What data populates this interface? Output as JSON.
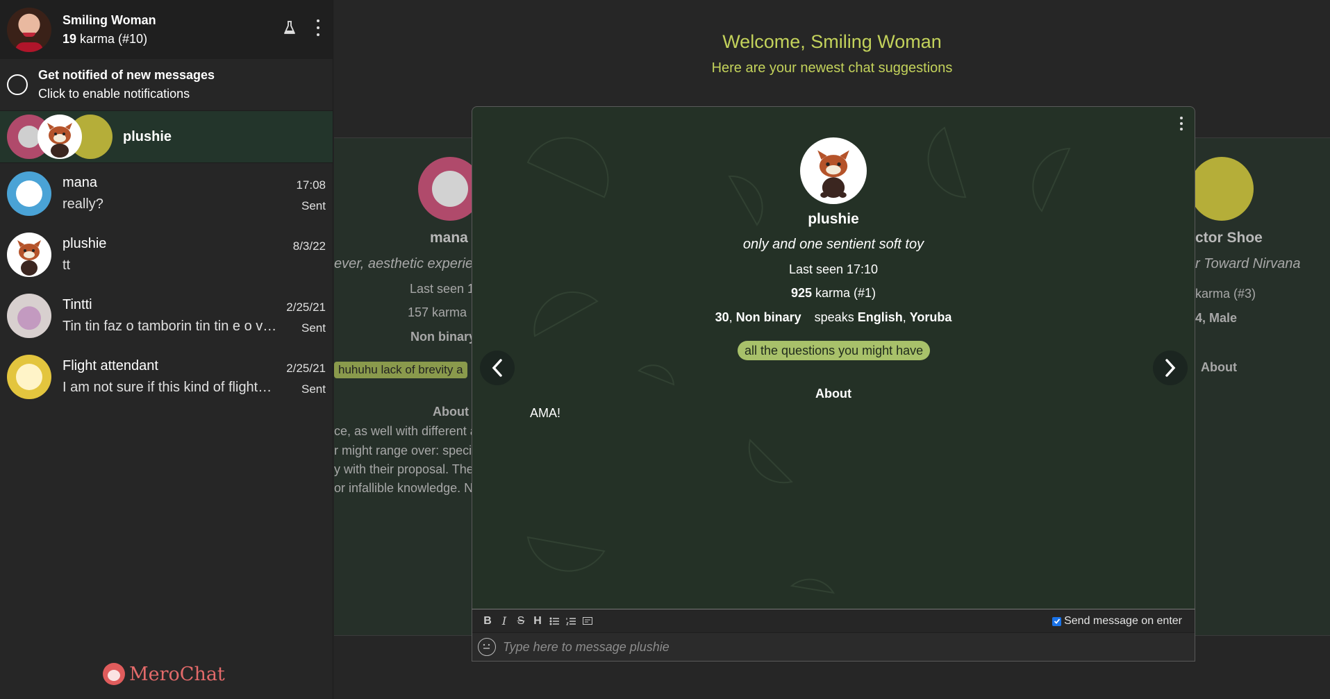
{
  "me": {
    "name": "Smiling Woman",
    "karma": "19",
    "karma_suffix": " karma (#10)"
  },
  "notifications": {
    "title": "Get notified of new messages",
    "subtitle": "Click to enable notifications"
  },
  "suggestions_entry": {
    "name": "plushie"
  },
  "chats": [
    {
      "name": "mana",
      "last": "really?",
      "time": "17:08",
      "status": "Sent"
    },
    {
      "name": "plushie",
      "last": "tt",
      "time": "8/3/22",
      "status": ""
    },
    {
      "name": "Tintti",
      "last": "Tin tin faz o tamborin tin tin e o vento faz",
      "time": "2/25/21",
      "status": "Sent"
    },
    {
      "name": "Flight attendant",
      "last": "I am not sure if this kind of flights are ok",
      "time": "2/25/21",
      "status": "Sent"
    }
  ],
  "brand": "MeroChat",
  "welcome": {
    "title": "Welcome, Smiling Woman",
    "subtitle": "Here are your newest chat suggestions"
  },
  "left_card": {
    "name": "mana",
    "headline": "ever, aesthetic experie",
    "seen": "Last seen 1",
    "karma": "157 karma",
    "details": "Non binary",
    "tag": "huhuhu lack of brevity a",
    "about_title": "About",
    "about_lines": [
      "ce, as well with different a",
      "r might range over: speci",
      "y with their proposal. The",
      "or infallible knowledge. No"
    ]
  },
  "right_card": {
    "name": "ctor Shoe",
    "headline": "r Toward Nirvana",
    "karma": " karma (#3)",
    "details": "4, Male",
    "about_title": "About"
  },
  "card": {
    "name": "plushie",
    "headline": "only and one sentient soft toy",
    "last_seen": "Last seen 17:10",
    "karma": "925",
    "karma_suffix": " karma (#1)",
    "age": "30",
    "gender": "Non binary",
    "speaks_label": "speaks",
    "languages": [
      "English",
      "Yoruba"
    ],
    "tag": "all the questions you might have",
    "about_title": "About",
    "about": "AMA!"
  },
  "composer": {
    "placeholder": "Type here to message plushie",
    "send_on_enter": "Send message on enter",
    "send_on_enter_checked": true,
    "tools": [
      "bold-icon",
      "italic-icon",
      "strikethrough-icon",
      "heading-icon",
      "bullet-list-icon",
      "numbered-list-icon",
      "preview-icon"
    ]
  },
  "colors": {
    "accent": "#c3d25b",
    "card_bg": "#243126",
    "sidebar_selected": "#23352b",
    "tag_bg": "#a8c16a",
    "brand": "#e36a6a"
  }
}
